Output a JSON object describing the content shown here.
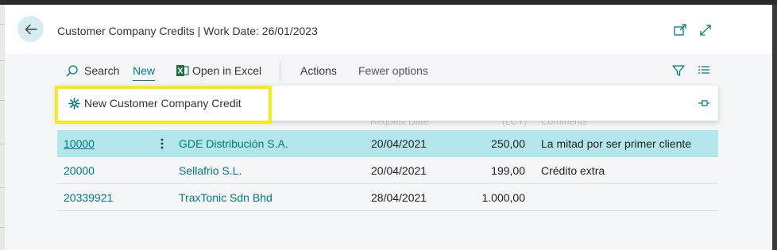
{
  "header": {
    "title": "Customer Company Credits | Work Date: 26/01/2023"
  },
  "toolbar": {
    "search_label": "Search",
    "new_label": "New",
    "excel_label": "Open in Excel",
    "actions_label": "Actions",
    "fewer_label": "Fewer options"
  },
  "dropdown": {
    "new_credit_label": "New Customer Company Credit"
  },
  "columns_ghost": {
    "request_date": "Request Date",
    "amount": "(LCY)",
    "comments": "Comments"
  },
  "rows": [
    {
      "no": "10000",
      "name": "GDE Distribución S.A.",
      "date": "20/04/2021",
      "amount": "250,00",
      "comment": "La mitad por ser primer cliente"
    },
    {
      "no": "20000",
      "name": "Sellafrio S.L.",
      "date": "20/04/2021",
      "amount": "199,00",
      "comment": "Crédito extra"
    },
    {
      "no": "20339921",
      "name": "TraxTonic Sdn Bhd",
      "date": "28/04/2021",
      "amount": "1.000,00",
      "comment": ""
    }
  ],
  "colors": {
    "accent": "#007a80",
    "selected_row": "#b3e6ea",
    "highlight": "#f5ea1f"
  }
}
